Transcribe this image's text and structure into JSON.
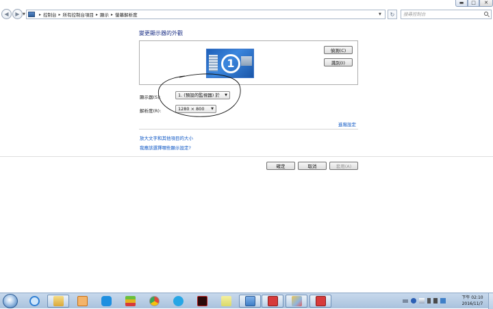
{
  "window": {
    "controls": {
      "minimize": "▬",
      "maximize": "□",
      "close": "✕"
    }
  },
  "navbar": {
    "back_glyph": "◀",
    "forward_glyph": "▶",
    "breadcrumbs": [
      "控制台",
      "所有控制台項目",
      "顯示",
      "螢幕解析度"
    ],
    "search_placeholder": "搜尋控制台",
    "refresh_glyph": "↻"
  },
  "main": {
    "title": "變更顯示器的外觀",
    "preview": {
      "monitor_number": "1"
    },
    "detect_button": "偵測(C)",
    "identify_button": "識別(I)",
    "display_label": "顯示器(S):",
    "display_value": "1. (預設的監視器) 於",
    "resolution_label": "解析度(R):",
    "resolution_value": "1280 × 800",
    "advanced_link": "進階設定",
    "text_size_link": "放大文字和其他項目的大小",
    "which_setting_link": "我應該選擇哪些顯示設定?",
    "ok_button": "確定",
    "cancel_button": "取消",
    "apply_button": "套用(A)"
  },
  "taskbar": {
    "clock_time": "下午 02:10",
    "clock_date": "2016/11/7",
    "colors": {
      "ie": "#2f7fd4",
      "explorer": "#e8c45a",
      "media": "#f08a2a",
      "arrow_app": "#1e8fe0",
      "bluestacks": "#6bbf3a",
      "chrome": "#e04a3a",
      "u_app": "#27a6e5",
      "kf_app": "#b81c1c",
      "folder_app": "#d9d96a",
      "display_app": "#3f7fc7",
      "red_app": "#d63b3b",
      "paint": "#8fb4dc"
    }
  }
}
